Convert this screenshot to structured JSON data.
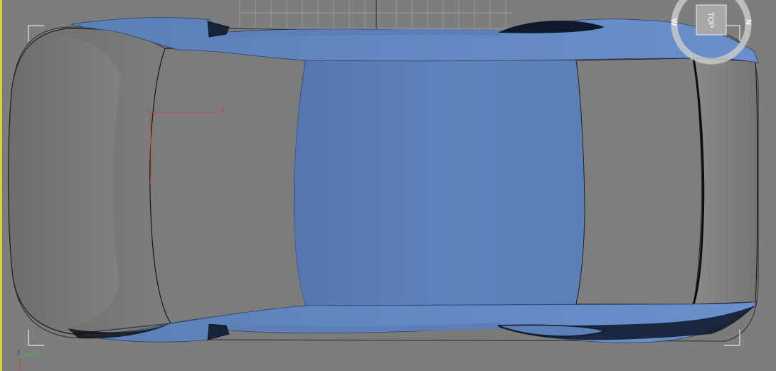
{
  "viewport": {
    "view_label": "TOP",
    "compass_labels": {
      "north": "N",
      "west": "W"
    },
    "local_gizmo_labels": {
      "x": "x",
      "y": "y"
    },
    "world_axis_labels": {
      "x": "x",
      "y": "y",
      "z": "z"
    }
  },
  "colors": {
    "background": "#7d7d7d",
    "active_viewport_border": "#d7d23a",
    "car_body_gray": "#7a7a7a",
    "selection_blue": "#5b80b8",
    "grid_line": "#9a9a9a",
    "local_axis_red": "#d83a3a"
  }
}
